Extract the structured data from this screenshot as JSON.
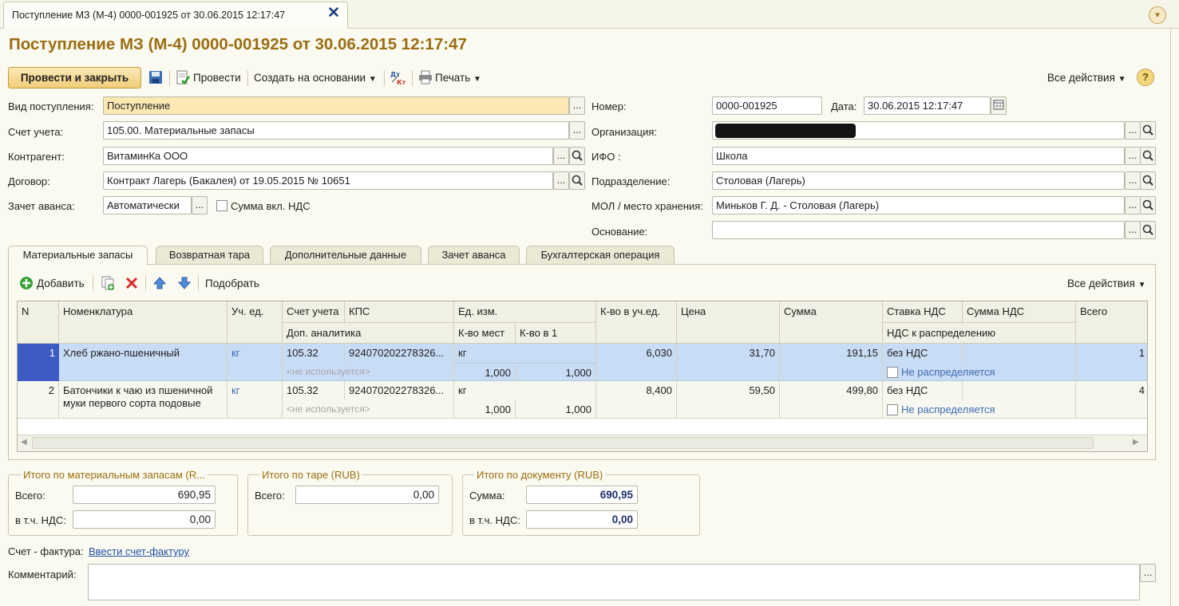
{
  "window": {
    "tab_title": "Поступление МЗ (М-4) 0000-001925 от 30.06.2015 12:17:47",
    "doc_title": "Поступление МЗ (М-4) 0000-001925 от 30.06.2015 12:17:47"
  },
  "toolbar": {
    "post_close": "Провести и закрыть",
    "post": "Провести",
    "create_based": "Создать на основании",
    "print": "Печать",
    "all_actions": "Все действия",
    "help": "?"
  },
  "form": {
    "vid_label": "Вид поступления:",
    "vid_value": "Поступление",
    "schet_label": "Счет учета:",
    "schet_value": "105.00. Материальные запасы",
    "kontragent_label": "Контрагент:",
    "kontragent_value": "ВитаминКа ООО",
    "dogovor_label": "Договор:",
    "dogovor_value": "Контракт Лагерь (Бакалея) от 19.05.2015 № 10651",
    "zachet_label": "Зачет аванса:",
    "zachet_value": "Автоматически",
    "summa_nds_label": "Сумма вкл. НДС",
    "nomer_label": "Номер:",
    "nomer_value": "0000-001925",
    "data_label": "Дата:",
    "data_value": "30.06.2015 12:17:47",
    "org_label": "Организация:",
    "ifo_label": "ИФО :",
    "ifo_value": "Школа",
    "podr_label": "Подразделение:",
    "podr_value": "Столовая (Лагерь)",
    "mol_label": "МОЛ / место хранения:",
    "mol_value": "Миньков Г. Д. - Столовая (Лагерь)",
    "osnovanie_label": "Основание:",
    "osnovanie_value": ""
  },
  "tabs": [
    "Материальные запасы",
    "Возвратная тара",
    "Дополнительные данные",
    "Зачет аванса",
    "Бухгалтерская операция"
  ],
  "table_toolbar": {
    "add": "Добавить",
    "select": "Подобрать",
    "all_actions": "Все действия"
  },
  "table": {
    "headers": {
      "n": "N",
      "nomenklatura": "Номенклатура",
      "uch_ed": "Уч. ед.",
      "schet": "Счет учета",
      "kps": "КПС",
      "dop_analitika": "Доп. аналитика",
      "ed_izm": "Ед. изм.",
      "kvo_mest": "К-во мест",
      "kvo_v1": "К-во в 1",
      "kvo_uch": "К-во в уч.ед.",
      "cena": "Цена",
      "summa": "Сумма",
      "stavka_nds": "Ставка НДС",
      "summa_nds": "Сумма НДС",
      "nds_raspr": "НДС к распределению",
      "vsego": "Всего"
    },
    "rows": [
      {
        "n": "1",
        "nomenklatura": "Хлеб ржано-пшеничный",
        "uch_ed": "кг",
        "schet": "105.32",
        "kps": "924070202278326...",
        "dop": "<не используется>",
        "ed_izm": "кг",
        "kvo_mest": "1,000",
        "kvo_v1": "1,000",
        "kvo_uch": "6,030",
        "cena": "31,70",
        "summa": "191,15",
        "stavka": "без НДС",
        "summa_nds": "",
        "raspr": "Не распределяется",
        "vsego": "1"
      },
      {
        "n": "2",
        "nomenklatura": "Батончики к чаю из пшеничной муки первого сорта подовые",
        "uch_ed": "кг",
        "schet": "105.32",
        "kps": "924070202278326...",
        "dop": "<не используется>",
        "ed_izm": "кг",
        "kvo_mest": "1,000",
        "kvo_v1": "1,000",
        "kvo_uch": "8,400",
        "cena": "59,50",
        "summa": "499,80",
        "stavka": "без НДС",
        "summa_nds": "",
        "raspr": "Не распределяется",
        "vsego": "4"
      }
    ]
  },
  "totals": {
    "mz_legend": "Итого по материальным запасам (R...",
    "mz_vsego_label": "Всего:",
    "mz_vsego": "690,95",
    "mz_nds_label": "в т.ч. НДС:",
    "mz_nds": "0,00",
    "tara_legend": "Итого по таре (RUB)",
    "tara_vsego_label": "Всего:",
    "tara_vsego": "0,00",
    "doc_legend": "Итого по документу (RUB)",
    "doc_summa_label": "Сумма:",
    "doc_summa": "690,95",
    "doc_nds_label": "в т.ч. НДС:",
    "doc_nds": "0,00"
  },
  "footer": {
    "invoice_label": "Счет - фактура:",
    "invoice_link": "Ввести счет-фактуру",
    "comment_label": "Комментарий:",
    "comment_value": ""
  },
  "colors": {
    "title": "#9a6d12",
    "selected_row": "#c9dcf5",
    "active_cell": "#3c5cc4",
    "main_button": "#f0cd79",
    "background": "#fbfaf0"
  }
}
